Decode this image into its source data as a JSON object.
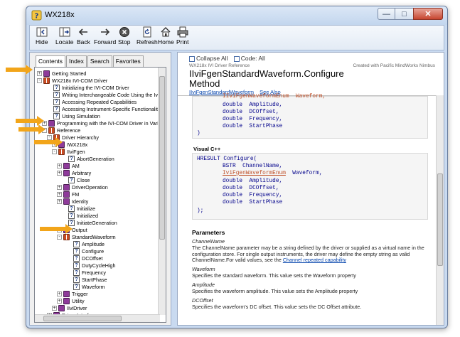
{
  "window": {
    "title": "WX218x"
  },
  "toolbar": {
    "hide": "Hide",
    "locate": "Locate",
    "back": "Back",
    "forward": "Forward",
    "stop": "Stop",
    "refresh": "Refresh",
    "home": "Home",
    "print": "Print"
  },
  "nav": {
    "tabs": [
      "Contents",
      "Index",
      "Search",
      "Favorites"
    ],
    "tree": [
      {
        "label": "Getting Started"
      },
      {
        "label": "WX218x IVI-COM Driver"
      },
      {
        "label": "Initializing the IVI-COM Driver"
      },
      {
        "label": "Writing Interchangeable Code Using the IviFgen"
      },
      {
        "label": "Accessing Repeated Capabilities"
      },
      {
        "label": "Accessing Instrument-Specific Functionality"
      },
      {
        "label": "Using Simulation"
      },
      {
        "label": "Programming with the IVI-COM Driver in Various"
      },
      {
        "label": "Reference"
      },
      {
        "label": "Driver Hierarchy"
      },
      {
        "label": "IWX218x"
      },
      {
        "label": "IIviFgen"
      },
      {
        "label": "AbortGeneration"
      },
      {
        "label": "AM"
      },
      {
        "label": "Arbitrary"
      },
      {
        "label": "Close"
      },
      {
        "label": "DriverOperation"
      },
      {
        "label": "FM"
      },
      {
        "label": "Identity"
      },
      {
        "label": "Initialize"
      },
      {
        "label": "Initialized"
      },
      {
        "label": "InitiateGeneration"
      },
      {
        "label": "Output"
      },
      {
        "label": "StandardWaveform"
      },
      {
        "label": "Amplitude"
      },
      {
        "label": "Configure"
      },
      {
        "label": "DCOffset"
      },
      {
        "label": "DutyCycleHigh"
      },
      {
        "label": "Frequency"
      },
      {
        "label": "StartPhase"
      },
      {
        "label": "Waveform"
      },
      {
        "label": "Trigger"
      },
      {
        "label": "Utility"
      },
      {
        "label": "IIviDriver"
      },
      {
        "label": "Driver Interfaces"
      }
    ]
  },
  "doc": {
    "collapse_all": "Collapse All",
    "code_all": "Code: All",
    "subheader": "WX218x IVI Driver Reference",
    "created": "Created with Pacific MindWorks Nimbus",
    "title": "IIviFgenStandardWaveform.Configure Method",
    "link1": "IIviFgenStandardWaveform",
    "link2": "See Also",
    "code1": [
      "double  Amplitude,",
      "double  DCOffset,",
      "double  Frequency,",
      "double  StartPhase",
      ")"
    ],
    "code1_partial": "IIviFgenWaveformEnum  Waveform,",
    "vc_header": "Visual C++",
    "code2_l1": "HRESULT Configure(",
    "code2_l2": "BSTR  ChannelName,",
    "code2_l3a": "IviFgenWaveformEnum",
    "code2_l3b": "  Waveform,",
    "code2_rest": [
      "double  Amplitude,",
      "double  DCOffset,",
      "double  Frequency,",
      "double  StartPhase"
    ],
    "code2_end": ");",
    "params_heading": "Parameters",
    "p_channel_name": "ChannelName",
    "p_channel_desc": "The ChannelName parameter may be a string defined by the driver or supplied as a virtual name in the configuration store. For single output instruments, the driver may define the empty string as valid ChannelName.For valid values, see the",
    "p_channel_link": "Channel repeated capability",
    "p_waveform_name": "Waveform",
    "p_waveform_desc": "Specifies the standard waveform. This value sets the Waveform property",
    "p_amplitude_name": "Amplitude",
    "p_amplitude_desc": "Specifies the waveform amplitude. This value sets the Amplitude property",
    "p_dcoffset_name": "DCOffset",
    "p_dcoffset_desc": "Specifies the waveform's DC offset. This value sets the DC Offset attribute."
  },
  "colors": {
    "arrow": "#f2a51a",
    "link": "#0645ad",
    "code": "#00008b",
    "enum": "#c05028"
  }
}
